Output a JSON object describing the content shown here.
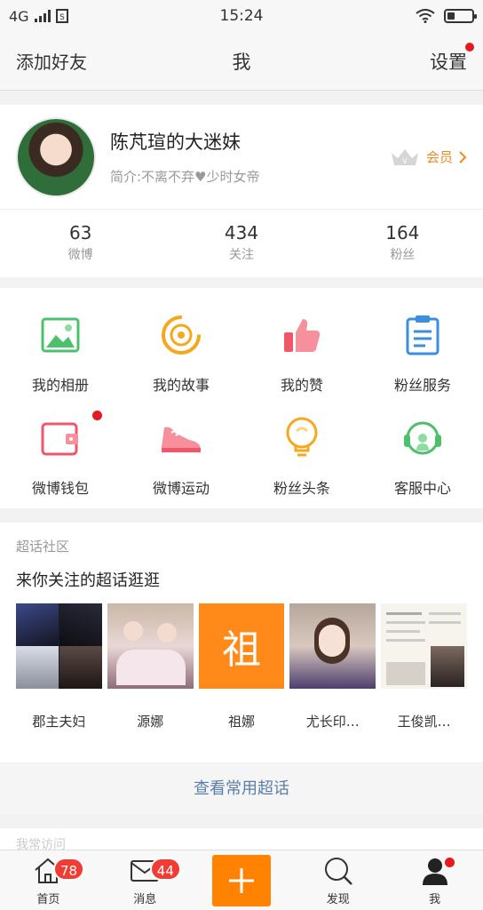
{
  "status_bar": {
    "network": "4G",
    "time": "15:24"
  },
  "nav": {
    "left_label": "添加好友",
    "title": "我",
    "right_label": "设置"
  },
  "profile": {
    "name": "陈芃瑄的大迷妹",
    "bio": "简介:不离不弃♥少时女帝",
    "vip_label": "会员",
    "stats": [
      {
        "value": "63",
        "label": "微博"
      },
      {
        "value": "434",
        "label": "关注"
      },
      {
        "value": "164",
        "label": "粉丝"
      }
    ]
  },
  "grid": {
    "items": [
      {
        "label": "我的相册",
        "icon": "photo-album-icon",
        "color": "#4cc06b"
      },
      {
        "label": "我的故事",
        "icon": "story-icon",
        "color": "#f7a71c"
      },
      {
        "label": "我的赞",
        "icon": "thumbs-up-icon",
        "color": "#f2566b"
      },
      {
        "label": "粉丝服务",
        "icon": "clipboard-icon",
        "color": "#3b8fe0"
      },
      {
        "label": "微博钱包",
        "icon": "wallet-icon",
        "color": "#f2566b"
      },
      {
        "label": "微博运动",
        "icon": "sneaker-icon",
        "color": "#f2566b"
      },
      {
        "label": "粉丝头条",
        "icon": "lightbulb-icon",
        "color": "#f7a71c"
      },
      {
        "label": "客服中心",
        "icon": "headset-icon",
        "color": "#4cc06b"
      }
    ]
  },
  "super_topics": {
    "title": "超话社区",
    "subtitle": "来你关注的超话逛逛",
    "items": [
      {
        "name": "郡主夫妇"
      },
      {
        "name": "源娜"
      },
      {
        "name": "祖娜",
        "thumb_text": "祖"
      },
      {
        "name": "尤长印…"
      },
      {
        "name": "王俊凯…"
      }
    ],
    "more_label": "查看常用超话"
  },
  "peek_text": "我常访问",
  "tab_bar": {
    "items": [
      {
        "label": "首页",
        "badge": "78",
        "icon": "home-icon"
      },
      {
        "label": "消息",
        "badge": "44",
        "icon": "message-icon"
      },
      {
        "label": "",
        "icon": "compose-plus-icon"
      },
      {
        "label": "发现",
        "icon": "discover-search-icon"
      },
      {
        "label": "我",
        "icon": "profile-icon"
      }
    ]
  },
  "colors": {
    "accent_orange": "#ff8200",
    "badge_red": "#f03c32",
    "link_blue": "#5a7ea8"
  }
}
